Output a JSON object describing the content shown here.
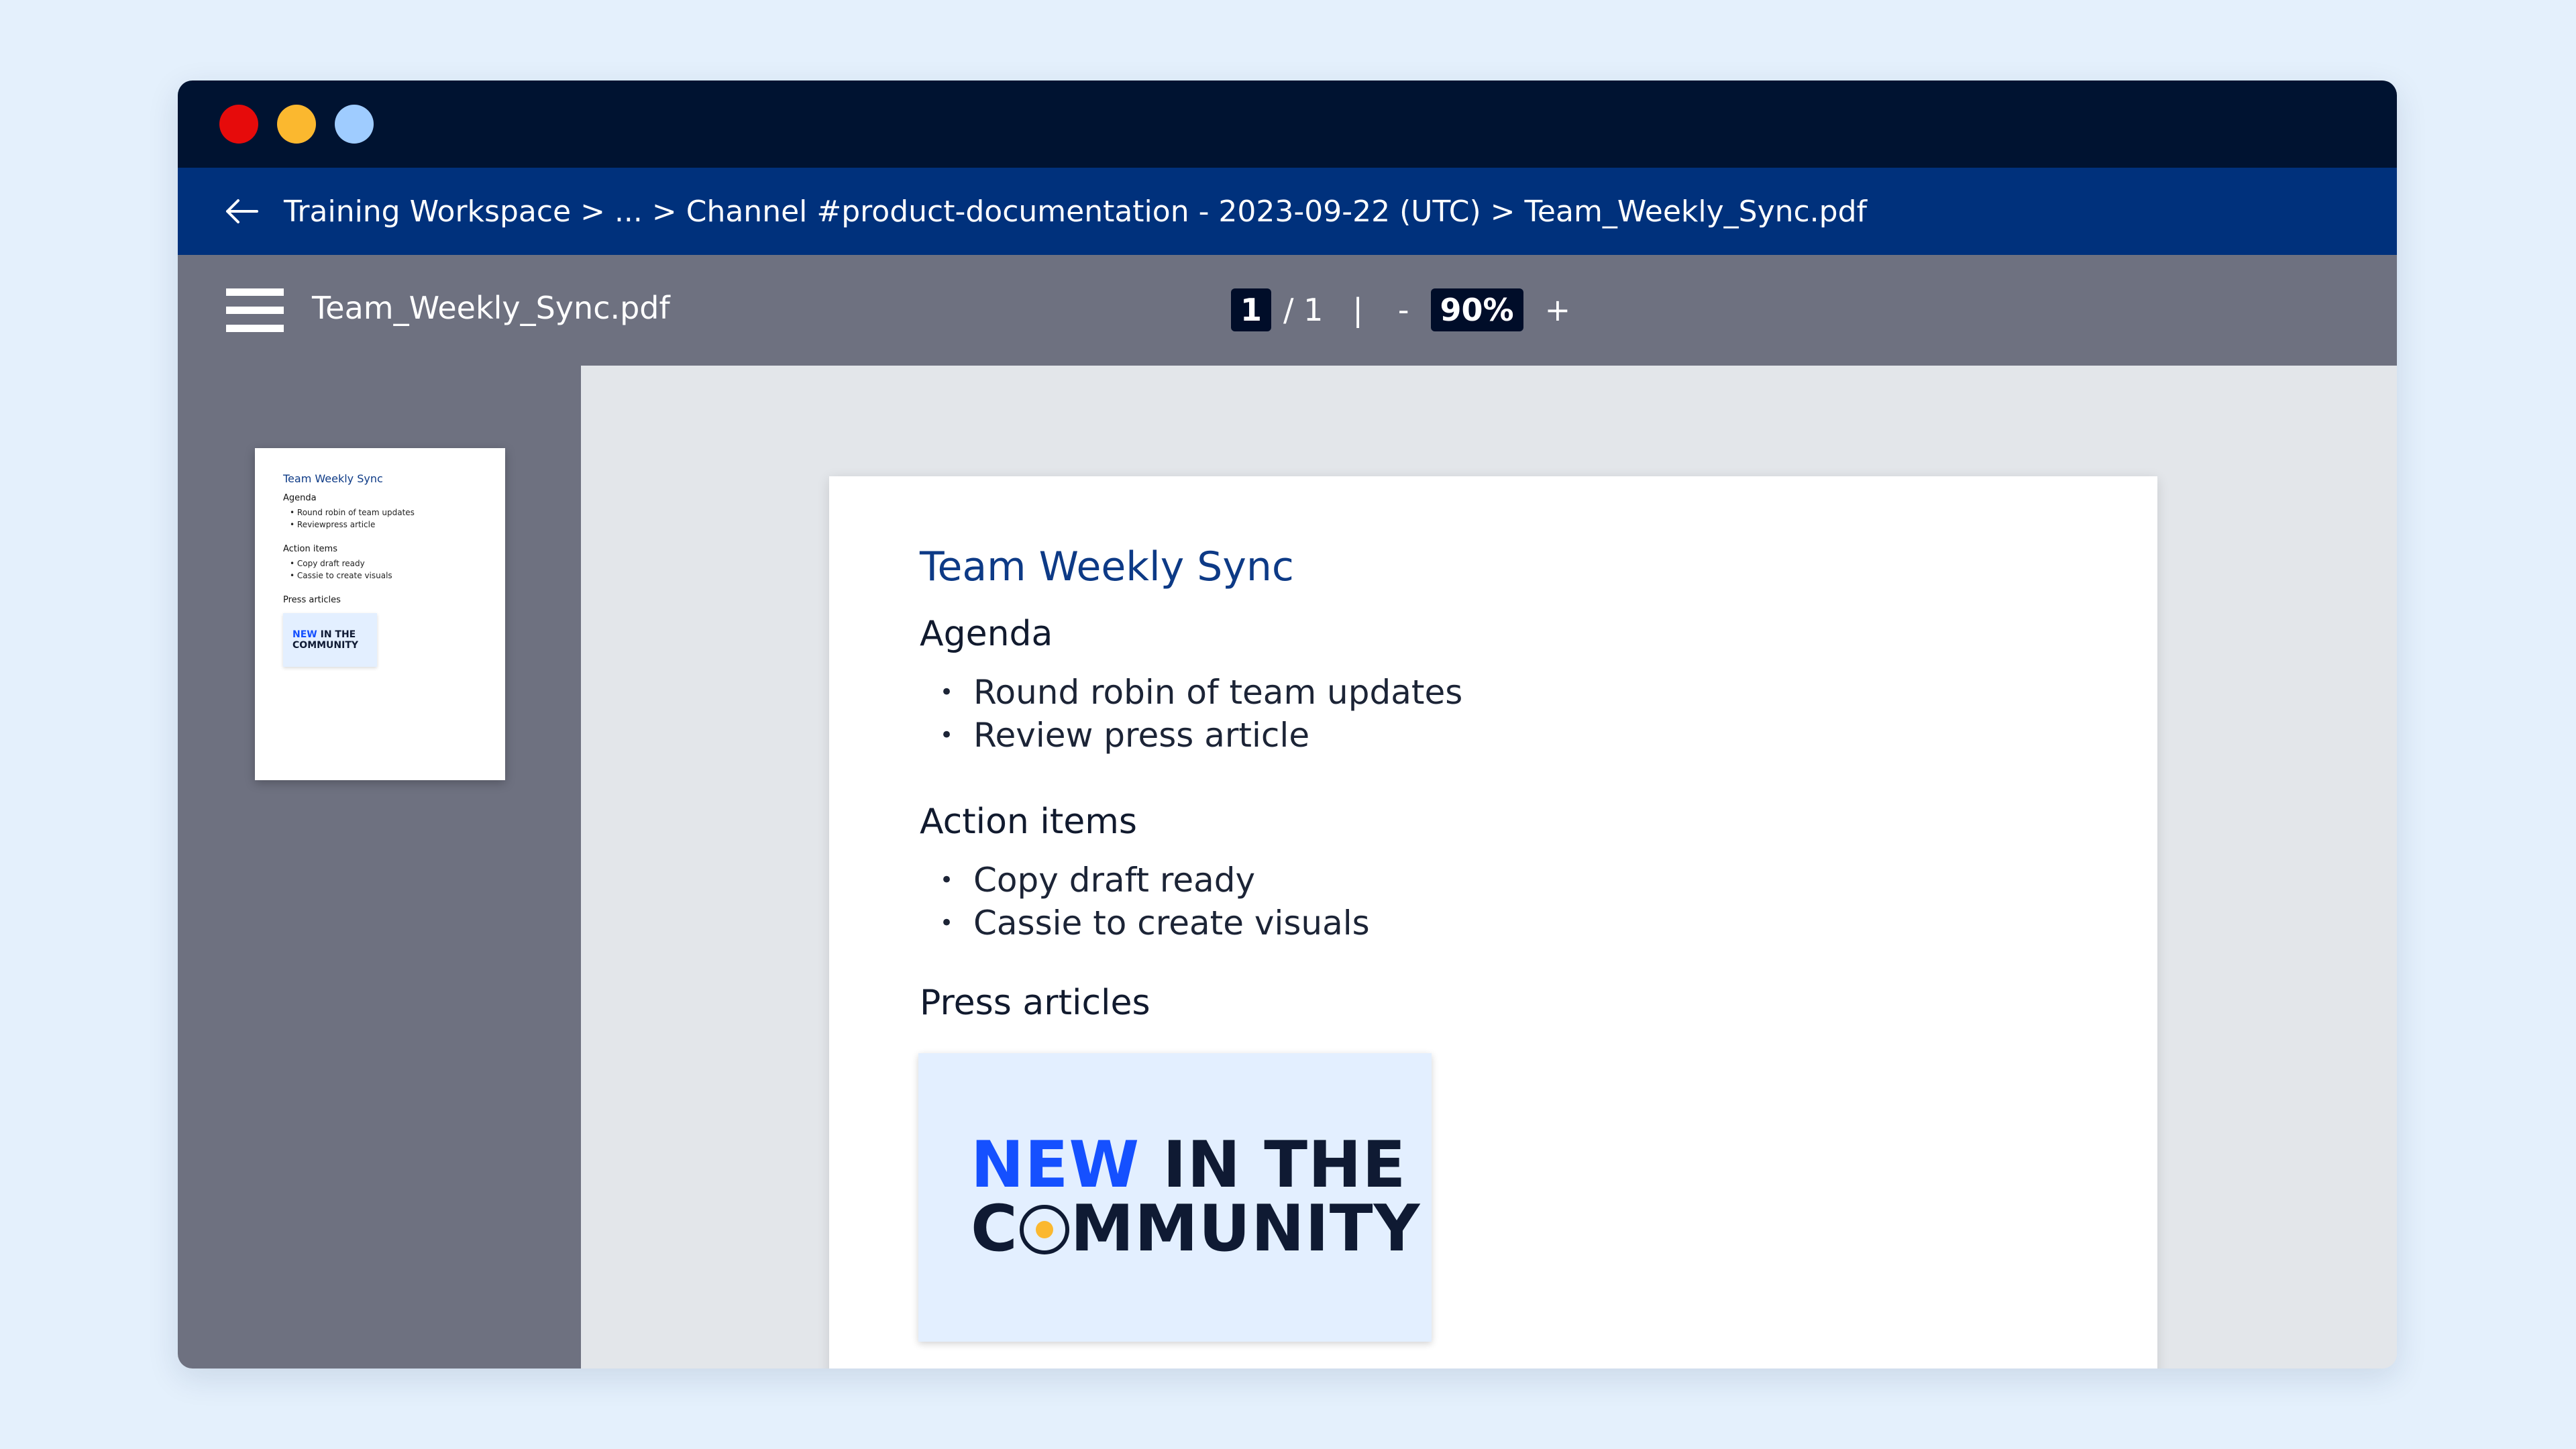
{
  "breadcrumb": {
    "text": "Training Workspace > ... > Channel #product-documentation - 2023-09-22 (UTC) > Team_Weekly_Sync.pdf"
  },
  "toolbar": {
    "filename": "Team_Weekly_Sync.pdf",
    "page_current": "1",
    "page_total": "/ 1",
    "separator": "|",
    "zoom_out": "-",
    "zoom_value": "90%",
    "zoom_in": "+"
  },
  "document": {
    "title": "Team Weekly Sync",
    "agenda_heading": "Agenda",
    "agenda_items": [
      "Round robin of team updates",
      "Review press article"
    ],
    "action_heading": "Action items",
    "action_items": [
      "Copy draft ready",
      "Cassie to create visuals"
    ],
    "press_heading": "Press articles",
    "press_image": {
      "word_new": "NEW",
      "line1_rest": "IN THE",
      "line2_start": "C",
      "line2_end": "MMUNITY"
    }
  },
  "thumbnail": {
    "agenda_item_2": "Reviewpress article"
  },
  "colors": {
    "titlebar": "#001331",
    "breadcrumb_bar": "#00317c",
    "toolbar": "#6e7180",
    "accent_title": "#0d3a86",
    "brand_blue": "#1550ff",
    "dot_red": "#e60b0b",
    "dot_yellow": "#fbb82f",
    "dot_blue": "#9fccff"
  }
}
